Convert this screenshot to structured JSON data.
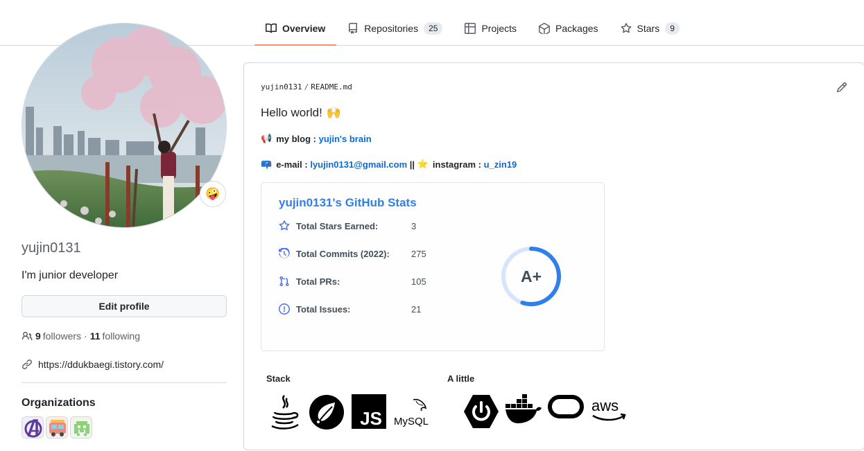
{
  "tabs": [
    {
      "label": "Overview",
      "icon": "book-icon",
      "active": true
    },
    {
      "label": "Repositories",
      "icon": "repo-icon",
      "count": "25"
    },
    {
      "label": "Projects",
      "icon": "table-icon"
    },
    {
      "label": "Packages",
      "icon": "package-icon"
    },
    {
      "label": "Stars",
      "icon": "star-icon",
      "count": "9"
    }
  ],
  "profile": {
    "username": "yujin0131",
    "bio": "I'm junior developer",
    "edit_label": "Edit profile",
    "followers_count": "9",
    "followers_label": "followers",
    "following_count": "11",
    "following_label": "following",
    "website": "https://ddukbaegi.tistory.com/",
    "status_emoji": "🤪",
    "organizations_title": "Organizations"
  },
  "readme": {
    "path_user": "yujin0131",
    "path_file": "README.md",
    "hello": "Hello world!",
    "hello_emoji": "🙌",
    "blog_emoji": "📢",
    "blog_label": "my blog :",
    "blog_link": "yujin's brain",
    "mail_emoji": "📪",
    "mail_label": "e-mail :",
    "mail_link": "lyujin0131@gmail.com",
    "mail_sep": "||",
    "insta_emoji": "⭐",
    "insta_label": "instagram :",
    "insta_link": "u_zin19"
  },
  "stats": {
    "title": "yujin0131's GitHub Stats",
    "rows": [
      {
        "label": "Total Stars Earned:",
        "value": "3"
      },
      {
        "label": "Total Commits (2022):",
        "value": "275"
      },
      {
        "label": "Total PRs:",
        "value": "105"
      },
      {
        "label": "Total Issues:",
        "value": "21"
      }
    ],
    "rank": "A+",
    "rank_progress": 0.55
  },
  "stack": {
    "stack_label": "Stack",
    "little_label": "A little",
    "mysql_text": "MySQL",
    "js_text": "JS",
    "aws_text": "aws"
  },
  "colors": {
    "accent_underline": "#fd8c73",
    "link": "#0969da",
    "stats_title": "#2f80ed",
    "stats_icon": "#4c71f2",
    "rank_ring": "#2f80ed"
  }
}
